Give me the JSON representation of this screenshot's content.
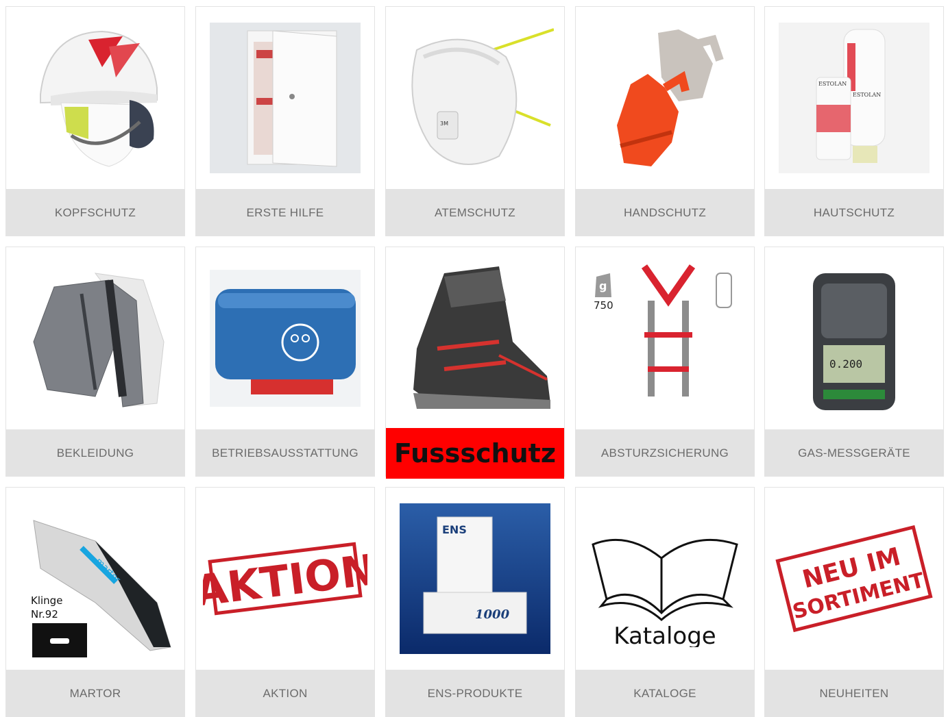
{
  "tiles": [
    {
      "label": "KOPFSCHUTZ",
      "icon": "helmet"
    },
    {
      "label": "ERSTE HILFE",
      "icon": "first-aid-cabinet"
    },
    {
      "label": "ATEMSCHUTZ",
      "icon": "respirator-mask"
    },
    {
      "label": "HANDSCHUTZ",
      "icon": "gloves"
    },
    {
      "label": "HAUTSCHUTZ",
      "icon": "skin-care-bottles",
      "product_text": [
        "ESTOLAN",
        "ESTOLAN"
      ]
    },
    {
      "label": "BEKLEIDUNG",
      "icon": "jackets"
    },
    {
      "label": "BETRIEBSAUSSTATTUNG",
      "icon": "storage-box"
    },
    {
      "label": "Fussschutz",
      "icon": "safety-boot",
      "active": true
    },
    {
      "label": "ABSTURZSICHERUNG",
      "icon": "harness",
      "weight_badge": "g",
      "weight": "750"
    },
    {
      "label": "GAS-MESSGERÄTE",
      "icon": "gas-detector",
      "display_value": "0.200"
    },
    {
      "label": "MARTOR",
      "icon": "safety-knife",
      "blade_label": "Klinge",
      "blade_number": "Nr.92",
      "brand": "martor"
    },
    {
      "label": "AKTION",
      "icon": "aktion-stamp",
      "stamp_text": "AKTION"
    },
    {
      "label": "ENS-PRODUKTE",
      "icon": "ens-boxes",
      "brand": "ENS",
      "count": "1000"
    },
    {
      "label": "KATALOGE",
      "icon": "open-book",
      "book_text": "Kataloge"
    },
    {
      "label": "NEUHEITEN",
      "icon": "new-stamp",
      "stamp_lines": [
        "NEU IM",
        "SORTIMENT"
      ]
    }
  ],
  "colors": {
    "caption_bg": "#e3e3e3",
    "caption_text": "#6b6b6b",
    "active_bg": "#ff0000"
  }
}
